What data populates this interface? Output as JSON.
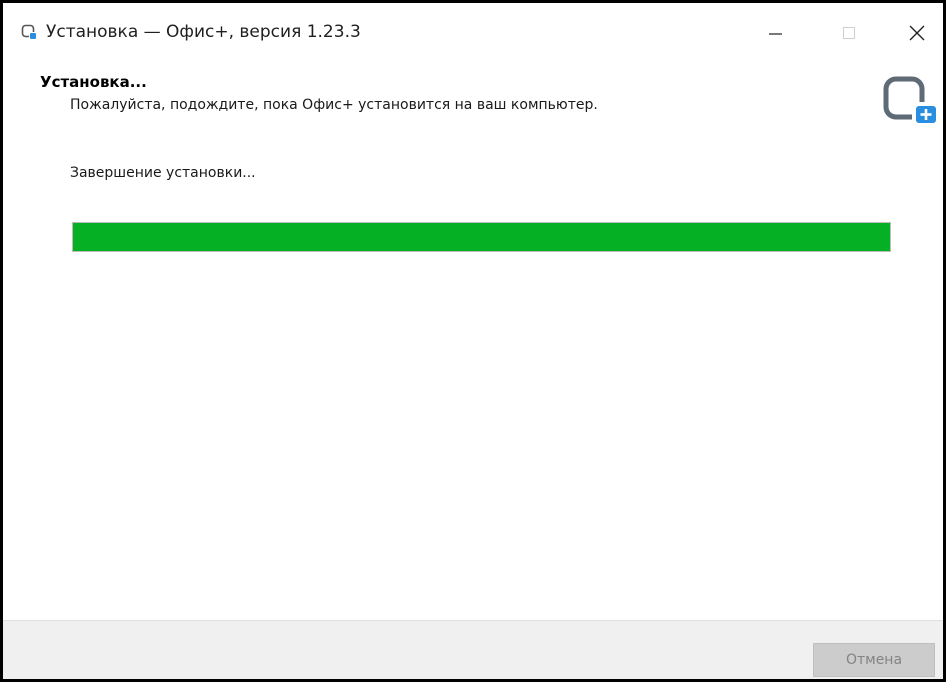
{
  "window": {
    "title": "Установка — Офис+, версия 1.23.3"
  },
  "header": {
    "title": "Установка...",
    "subtitle": "Пожалуйста, подождите, пока Офис+ установится на ваш компьютер.",
    "logo_icon": "office-plus-logo-icon"
  },
  "status": {
    "text": "Завершение установки..."
  },
  "progress": {
    "percent": 100,
    "color": "#06b025"
  },
  "footer": {
    "cancel_label": "Отмена",
    "cancel_enabled": false
  },
  "colors": {
    "accent": "#2a8ee0",
    "progress": "#06b025"
  }
}
